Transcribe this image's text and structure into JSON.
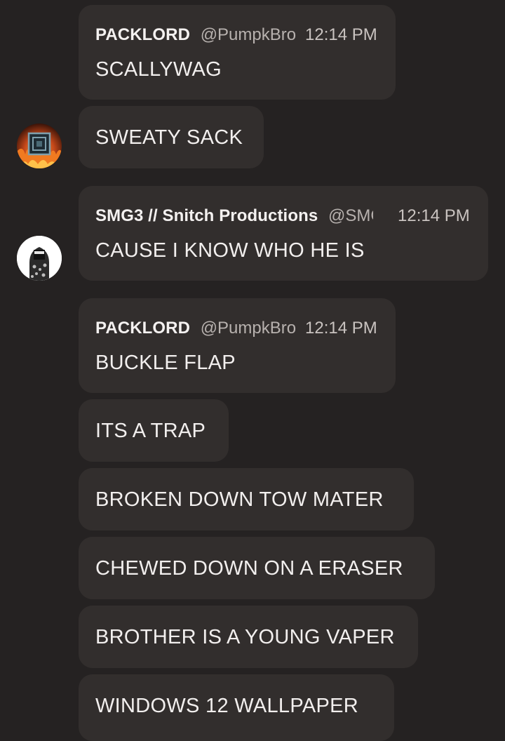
{
  "messages": [
    {
      "author": "PACKLORD",
      "handle": "@PumpkBro",
      "time": "12:14 PM",
      "text": "SCALLYWAG"
    },
    {
      "text": "SWEATY SACK"
    },
    {
      "author": "SMG3 // Snitch Productions",
      "handle": "@SMG",
      "time": "12:14 PM",
      "text": "CAUSE I KNOW WHO HE IS"
    },
    {
      "author": "PACKLORD",
      "handle": "@PumpkBro",
      "time": "12:14 PM",
      "text": "BUCKLE FLAP"
    },
    {
      "text": "ITS A TRAP"
    },
    {
      "text": "BROKEN DOWN TOW MATER"
    },
    {
      "text": "CHEWED DOWN ON A ERASER"
    },
    {
      "text": "BROTHER IS A YOUNG VAPER"
    },
    {
      "text": "WINDOWS 12 WALLPAPER"
    }
  ],
  "avatars": {
    "packlord": {
      "icon": "fire-frame-avatar-icon"
    },
    "smg3": {
      "icon": "hooded-figure-avatar-icon"
    }
  },
  "colors": {
    "background": "#252222",
    "bubble": "#322e2d",
    "text": "#f2efee",
    "handle": "#b7b1ae"
  }
}
